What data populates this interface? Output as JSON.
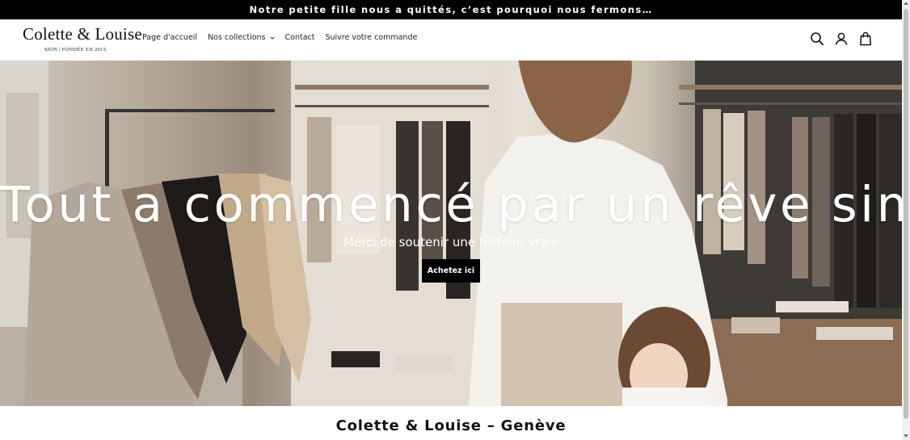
{
  "announcement": {
    "text": "Notre petite fille nous a quittés, c’est pourquoi nous fermons…"
  },
  "header": {
    "logo": {
      "name": "Colette & Louise",
      "tagline": "SION | FONDÉE EN 2015"
    },
    "nav": [
      {
        "label": "Page d'accueil",
        "icon": null
      },
      {
        "label": "Nos collections",
        "icon": "chevron-down-icon"
      },
      {
        "label": "Contact",
        "icon": null
      },
      {
        "label": "Suivre votre commande",
        "icon": null
      }
    ],
    "icons": [
      "search-icon",
      "account-icon",
      "cart-bag-icon"
    ]
  },
  "hero": {
    "title": "Tout a commencé par un rêve simple.",
    "subtitle": "Merci de soutenir une histoire vraie",
    "cta_label": "Achetez ici",
    "background": "photo-boutique-mother-daughter-clothing-racks"
  },
  "section": {
    "title": "Colette & Louise – Genève"
  },
  "colors": {
    "announcement_bg": "#000000",
    "button_bg": "#000000",
    "text_light": "#ffffff",
    "text_dark": "#111111"
  }
}
